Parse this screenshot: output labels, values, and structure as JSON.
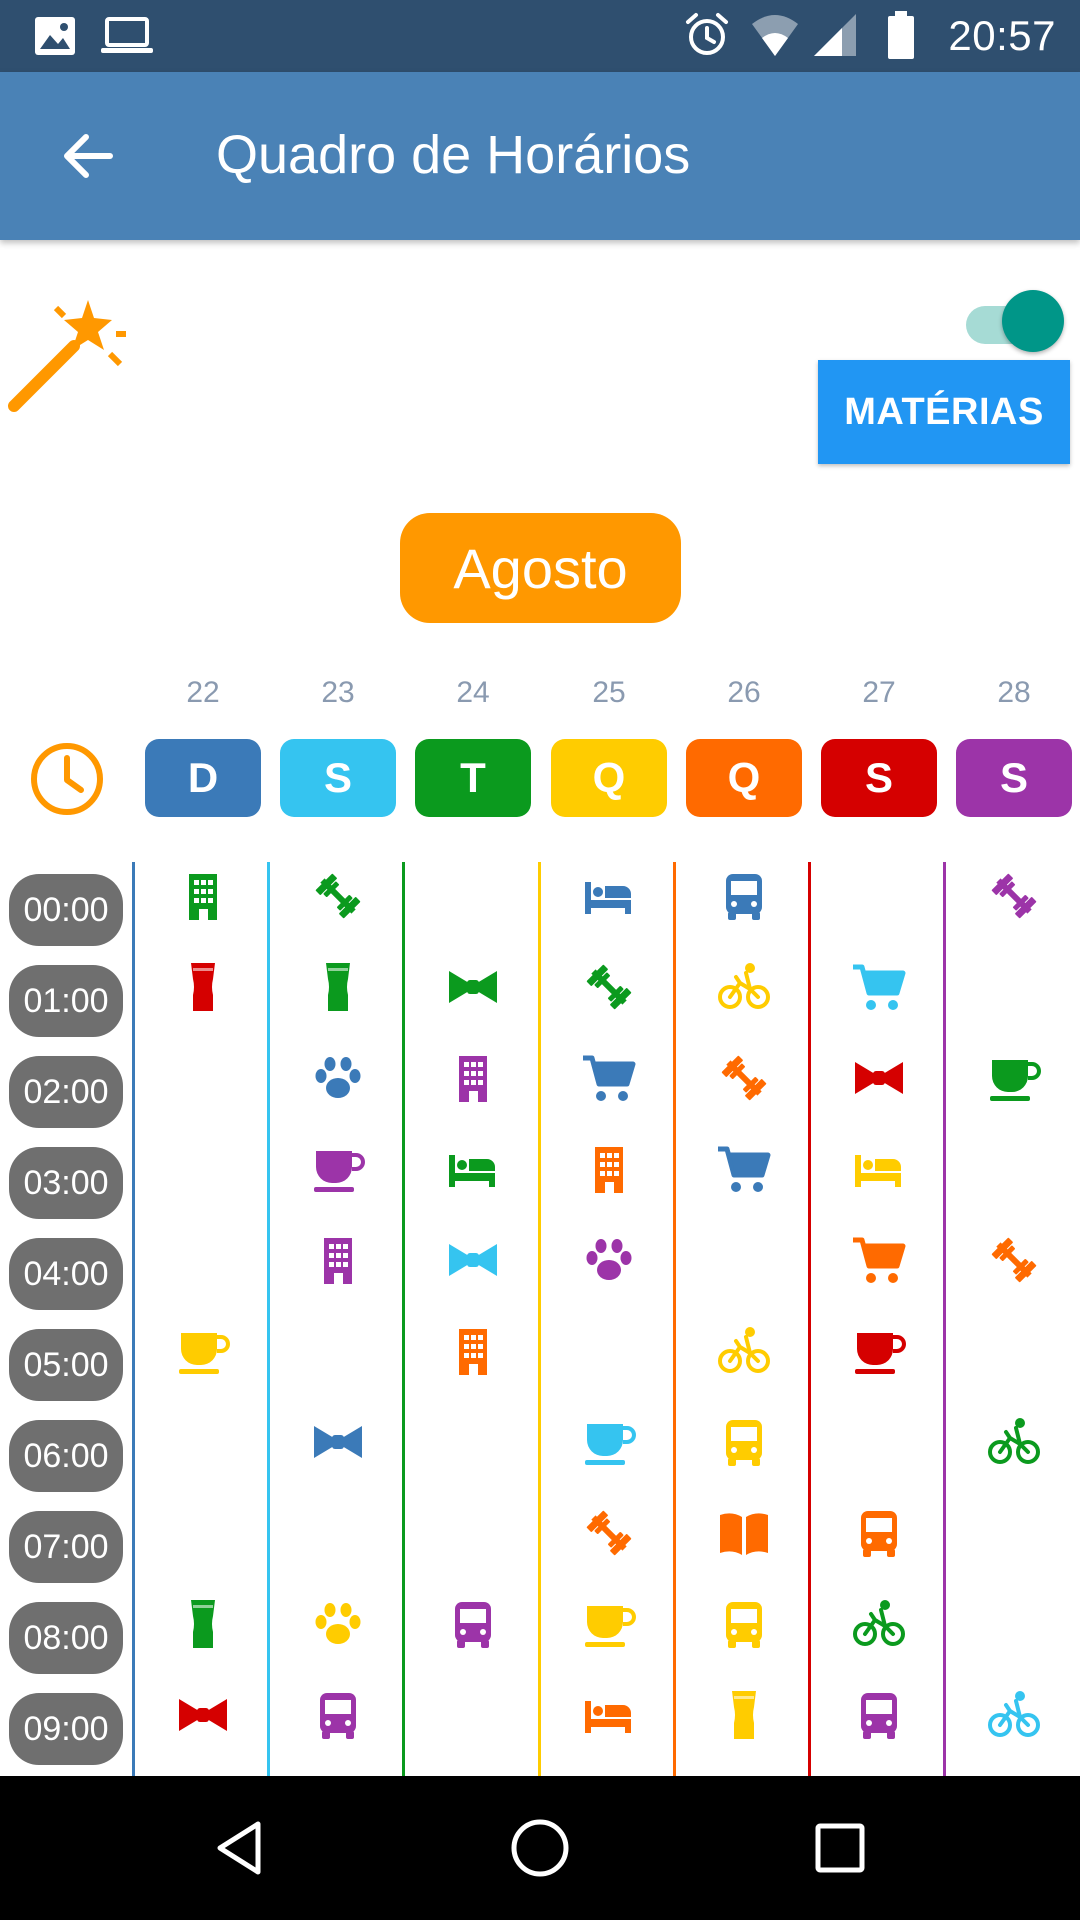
{
  "status_bar": {
    "time": "20:57",
    "icons": [
      "image-icon",
      "laptop-icon",
      "alarm-icon",
      "wifi-icon",
      "signal-icon",
      "battery-icon"
    ]
  },
  "app_bar": {
    "title": "Quadro de Horários",
    "back_icon": "arrow-back-icon"
  },
  "controls": {
    "wand_icon": "magic-wand-icon",
    "toggle_on": true,
    "materias_label": "MATÉRIAS"
  },
  "month": "Agosto",
  "days": [
    {
      "num": "22",
      "letter": "D",
      "color": "#3b7ab8"
    },
    {
      "num": "23",
      "letter": "S",
      "color": "#35c4f0"
    },
    {
      "num": "24",
      "letter": "T",
      "color": "#0b9a1e"
    },
    {
      "num": "25",
      "letter": "Q",
      "color": "#ffcc00"
    },
    {
      "num": "26",
      "letter": "Q",
      "color": "#ff6a00"
    },
    {
      "num": "27",
      "letter": "S",
      "color": "#d50000"
    },
    {
      "num": "28",
      "letter": "S",
      "color": "#9c34a8"
    }
  ],
  "hours": [
    "00:00",
    "01:00",
    "02:00",
    "03:00",
    "04:00",
    "05:00",
    "06:00",
    "07:00",
    "08:00",
    "09:00"
  ],
  "grid": [
    [
      "building:#0b9a1e",
      "dumbbell:#0b9a1e",
      "",
      "bed:#3b7ab8",
      "bus:#3b7ab8",
      "",
      "dumbbell:#9c34a8"
    ],
    [
      "beer:#d50000",
      "beer:#0b9a1e",
      "bowtie:#0b9a1e",
      "dumbbell:#0b9a1e",
      "bike:#ffcc00",
      "cart:#35c4f0",
      ""
    ],
    [
      "",
      "paw:#3b7ab8",
      "building:#9c34a8",
      "cart:#3b7ab8",
      "dumbbell:#ff6a00",
      "bowtie:#d50000",
      "cup:#0b9a1e"
    ],
    [
      "",
      "cup:#9c34a8",
      "bed:#0b9a1e",
      "building:#ff6a00",
      "cart:#3b7ab8",
      "bed:#ffcc00",
      ""
    ],
    [
      "",
      "building:#9c34a8",
      "bowtie:#35c4f0",
      "paw:#9c34a8",
      "",
      "cart:#ff6a00",
      "dumbbell:#ff6a00"
    ],
    [
      "cup:#ffcc00",
      "",
      "building:#ff6a00",
      "",
      "bike:#ffcc00",
      "cup:#d50000",
      ""
    ],
    [
      "",
      "bowtie:#3b7ab8",
      "",
      "cup:#35c4f0",
      "bus:#ffcc00",
      "",
      "bike:#0b9a1e"
    ],
    [
      "",
      "",
      "",
      "dumbbell:#ff6a00",
      "book:#ff6a00",
      "bus:#ff6a00",
      ""
    ],
    [
      "beer:#0b9a1e",
      "paw:#ffcc00",
      "bus:#9c34a8",
      "cup:#ffcc00",
      "bus:#ffcc00",
      "bike:#0b9a1e",
      ""
    ],
    [
      "bowtie:#d50000",
      "bus:#9c34a8",
      "",
      "bed:#ff6a00",
      "beer:#ffcc00",
      "bus:#9c34a8",
      "bike:#35c4f0"
    ]
  ],
  "nav_bar": [
    "back-triangle-icon",
    "home-circle-icon",
    "recents-square-icon"
  ]
}
